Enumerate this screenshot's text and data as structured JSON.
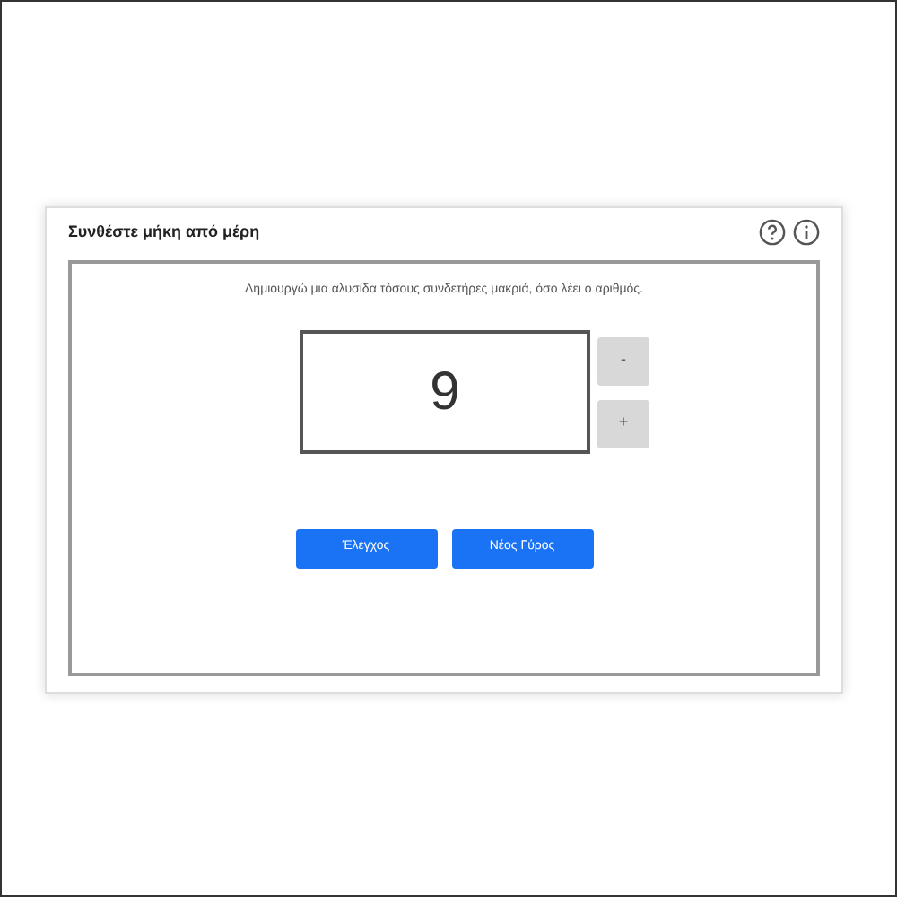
{
  "panel": {
    "title": "Συνθέστε μήκη από μέρη"
  },
  "instruction": "Δημιουργώ μια αλυσίδα τόσους συνδετήρες μακριά, όσο λέει ο αριθμός.",
  "number": "9",
  "steppers": [
    "-",
    "+"
  ],
  "buttons": [
    "Έλεγχος",
    "Νέος Γύρος"
  ]
}
